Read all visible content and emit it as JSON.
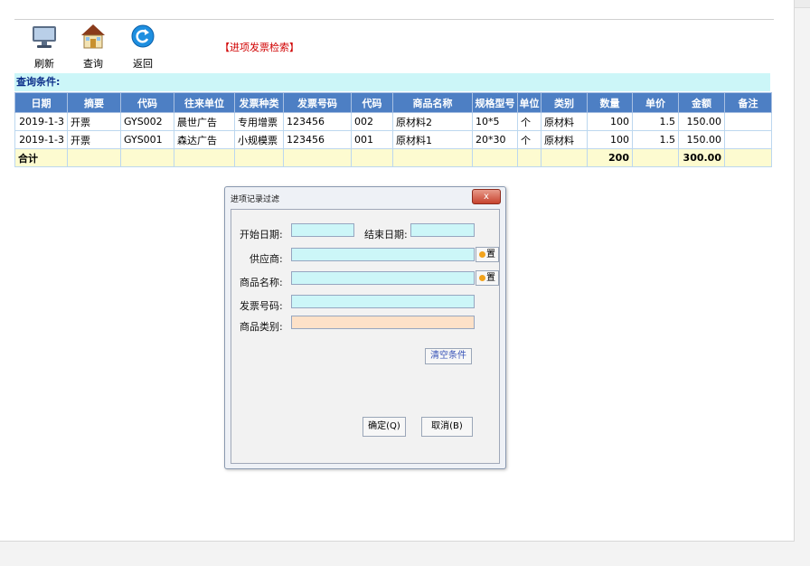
{
  "toolbar": {
    "refresh_label": "刷新",
    "query_label": "查询",
    "back_label": "返回"
  },
  "module_title": "【进项发票检索】",
  "query_bar": "查询条件:",
  "table": {
    "headers": [
      "日期",
      "摘要",
      "代码",
      "往来单位",
      "发票种类",
      "发票号码",
      "代码",
      "商品名称",
      "规格型号",
      "单位",
      "类别",
      "数量",
      "单价",
      "金额",
      "备注"
    ],
    "rows": [
      [
        "2019-1-3",
        "开票",
        "GYS002",
        "晨世广告",
        "专用增票",
        "123456",
        "002",
        "原材料2",
        "10*5",
        "个",
        "原材料",
        "100",
        "1.5",
        "150.00",
        ""
      ],
      [
        "2019-1-3",
        "开票",
        "GYS001",
        "森达广告",
        "小规模票",
        "123456",
        "001",
        "原材料1",
        "20*30",
        "个",
        "原材料",
        "100",
        "1.5",
        "150.00",
        ""
      ]
    ],
    "total": {
      "label": "合计",
      "quantity": "200",
      "amount": "300.00"
    }
  },
  "dialog": {
    "title": "进项记录过滤",
    "close_label": "x",
    "start_date_label": "开始日期:",
    "start_date_value": "",
    "end_date_label": "结束日期:",
    "end_date_value": "",
    "supplier_label": "供应商:",
    "supplier_value": "",
    "product_label": "商品名称:",
    "product_value": "",
    "invoice_no_label": "发票号码:",
    "invoice_no_value": "",
    "category_label": "商品类别:",
    "category_value": "",
    "set_label": "置",
    "clear_label": "清空条件",
    "ok_label": "确定(Q)",
    "cancel_label": "取消(B)"
  },
  "colors": {
    "header_blue": "#4d7fc4",
    "query_bar_cyan": "#ccf6f8",
    "total_row_yellow": "#fdfbd0",
    "title_red": "#d00000"
  }
}
